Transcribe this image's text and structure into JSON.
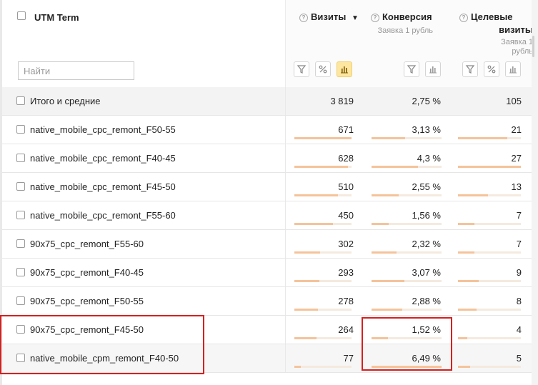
{
  "header": {
    "dimension_label": "UTM Term",
    "search_placeholder": "Найти",
    "columns": [
      {
        "title": "Визиты",
        "sort_icon": "▼",
        "subtitle_lines": []
      },
      {
        "title": "Конверсия",
        "subtitle_lines": [
          "Заявка 1 рубль"
        ]
      },
      {
        "title_lines": [
          "Целевые",
          "визиты"
        ],
        "subtitle_lines": [
          "Заявка 1",
          "рубль"
        ]
      }
    ],
    "active_color": "#fde6a0"
  },
  "totals": {
    "label": "Итого и средние",
    "visits": "3 819",
    "conversion": "2,75 %",
    "goal_visits": "105"
  },
  "rows": [
    {
      "label": "native_mobile_cpc_remont_F50-55",
      "visits": "671",
      "conversion": "3,13 %",
      "goal_visits": "21",
      "visits_bar": 1.0,
      "conversion_bar": 0.48,
      "goal_bar": 0.78
    },
    {
      "label": "native_mobile_cpc_remont_F40-45",
      "visits": "628",
      "conversion": "4,3 %",
      "goal_visits": "27",
      "visits_bar": 0.94,
      "conversion_bar": 0.66,
      "goal_bar": 1.0
    },
    {
      "label": "native_mobile_cpc_remont_F45-50",
      "visits": "510",
      "conversion": "2,55 %",
      "goal_visits": "13",
      "visits_bar": 0.76,
      "conversion_bar": 0.39,
      "goal_bar": 0.48
    },
    {
      "label": "native_mobile_cpc_remont_F55-60",
      "visits": "450",
      "conversion": "1,56 %",
      "goal_visits": "7",
      "visits_bar": 0.67,
      "conversion_bar": 0.24,
      "goal_bar": 0.26
    },
    {
      "label": "90x75_cpc_remont_F55-60",
      "visits": "302",
      "conversion": "2,32 %",
      "goal_visits": "7",
      "visits_bar": 0.45,
      "conversion_bar": 0.36,
      "goal_bar": 0.26
    },
    {
      "label": "90x75_cpc_remont_F40-45",
      "visits": "293",
      "conversion": "3,07 %",
      "goal_visits": "9",
      "visits_bar": 0.44,
      "conversion_bar": 0.47,
      "goal_bar": 0.33
    },
    {
      "label": "90x75_cpc_remont_F50-55",
      "visits": "278",
      "conversion": "2,88 %",
      "goal_visits": "8",
      "visits_bar": 0.41,
      "conversion_bar": 0.44,
      "goal_bar": 0.3
    },
    {
      "label": "90x75_cpc_remont_F45-50",
      "visits": "264",
      "conversion": "1,52 %",
      "goal_visits": "4",
      "visits_bar": 0.39,
      "conversion_bar": 0.23,
      "goal_bar": 0.15
    },
    {
      "label": "native_mobile_cpm_remont_F40-50",
      "visits": "77",
      "conversion": "6,49 %",
      "goal_visits": "5",
      "visits_bar": 0.11,
      "conversion_bar": 1.0,
      "goal_bar": 0.19
    }
  ],
  "colors": {
    "bar": "#f5c39a",
    "bar_track": "#f5eadf",
    "highlight": "#d61f1f"
  }
}
